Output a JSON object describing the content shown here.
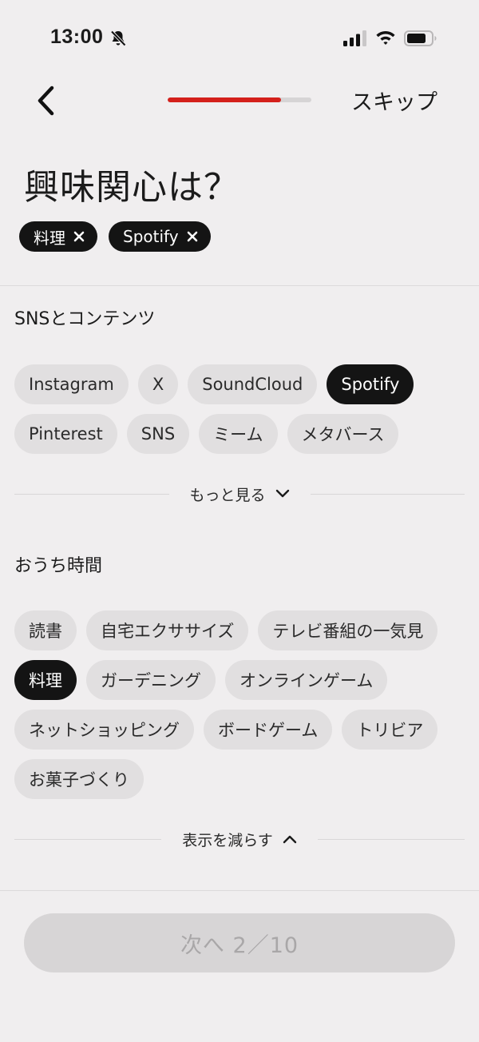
{
  "status_bar": {
    "time": "13:00",
    "icons": [
      "bell-slash-icon",
      "cellular-signal-icon",
      "wifi-icon",
      "battery-icon"
    ]
  },
  "nav": {
    "back_icon": "chevron-left-icon",
    "progress": 0.79,
    "progress_color": "#d4201b",
    "skip_label": "スキップ"
  },
  "title": "興味関心は？",
  "selected_tags": [
    {
      "label": "料理"
    },
    {
      "label": "Spotify"
    }
  ],
  "sections": [
    {
      "title": "SNSとコンテンツ",
      "chips": [
        {
          "label": "Instagram",
          "selected": false
        },
        {
          "label": "X",
          "selected": false
        },
        {
          "label": "SoundCloud",
          "selected": false
        },
        {
          "label": "Spotify",
          "selected": true
        },
        {
          "label": "Pinterest",
          "selected": false
        },
        {
          "label": "SNS",
          "selected": false
        },
        {
          "label": "ミーム",
          "selected": false
        },
        {
          "label": "メタバース",
          "selected": false
        }
      ],
      "toggle_label": "もっと見る",
      "toggle_icon": "chevron-down-icon"
    },
    {
      "title": "おうち時間",
      "chips": [
        {
          "label": "読書",
          "selected": false
        },
        {
          "label": "自宅エクササイズ",
          "selected": false
        },
        {
          "label": "テレビ番組の一気見",
          "selected": false
        },
        {
          "label": "料理",
          "selected": true
        },
        {
          "label": "ガーデニング",
          "selected": false
        },
        {
          "label": "オンラインゲーム",
          "selected": false
        },
        {
          "label": "ネットショッピング",
          "selected": false
        },
        {
          "label": "ボードゲーム",
          "selected": false
        },
        {
          "label": "トリビア",
          "selected": false
        },
        {
          "label": "お菓子づくり",
          "selected": false
        }
      ],
      "toggle_label": "表示を減らす",
      "toggle_icon": "chevron-up-icon"
    }
  ],
  "next_button": {
    "label": "次へ 2／10"
  }
}
